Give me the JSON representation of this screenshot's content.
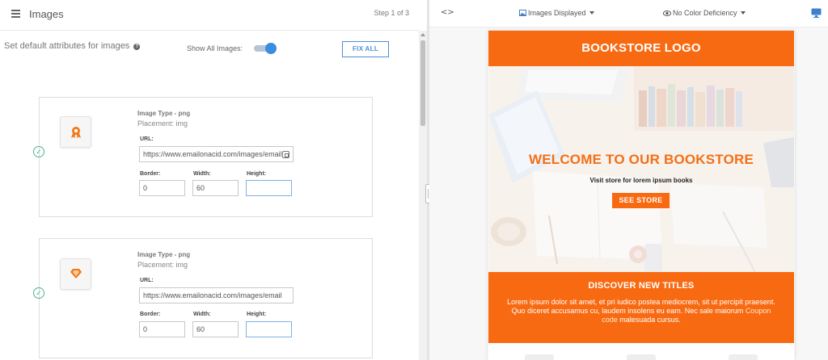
{
  "header": {
    "title": "Images",
    "step": "Step 1 of 3"
  },
  "settings": {
    "defaults_label": "Set default attributes for images",
    "help_icon": "?",
    "show_all_label": "Show All Images:",
    "show_all_on": true,
    "fix_all_label": "FIX ALL"
  },
  "images": [
    {
      "type": "Image Type - png",
      "placement": "Placement: img",
      "icon": "ribbon-badge-icon",
      "url_label": "URL:",
      "url": "https://www.emailonacid.com/images/email",
      "border_label": "Border:",
      "border": "0",
      "width_label": "Width:",
      "width": "60",
      "height_label": "Height:",
      "height": ""
    },
    {
      "type": "Image Type - png",
      "placement": "Placement: img",
      "icon": "diamond-icon",
      "url_label": "URL:",
      "url": "https://www.emailonacid.com/images/email",
      "border_label": "Border:",
      "border": "0",
      "width_label": "Width:",
      "width": "60",
      "height_label": "Height:",
      "height": ""
    }
  ],
  "preview": {
    "code_toggle": "<>",
    "images_dropdown": "Images Displayed",
    "color_dropdown": "No Color Deficiency",
    "accent": "#f86a12",
    "email": {
      "logo": "BOOKSTORE LOGO",
      "welcome": "WELCOME TO OUR BOOKSTORE",
      "visit": "Visit store for lorem ipsum books",
      "cta": "SEE STORE",
      "section_title": "DISCOVER NEW TITLES",
      "body_text": "Lorem ipsum dolor sit amet, et pri iudico postea mediocrem, sit ut percipit praesent. Quo diceret accusamus cu, laudem insolens eu eam. Nec sale maiorum",
      "coupon_link": "Coupon code",
      "body_tail": "malesuada cursus."
    }
  }
}
